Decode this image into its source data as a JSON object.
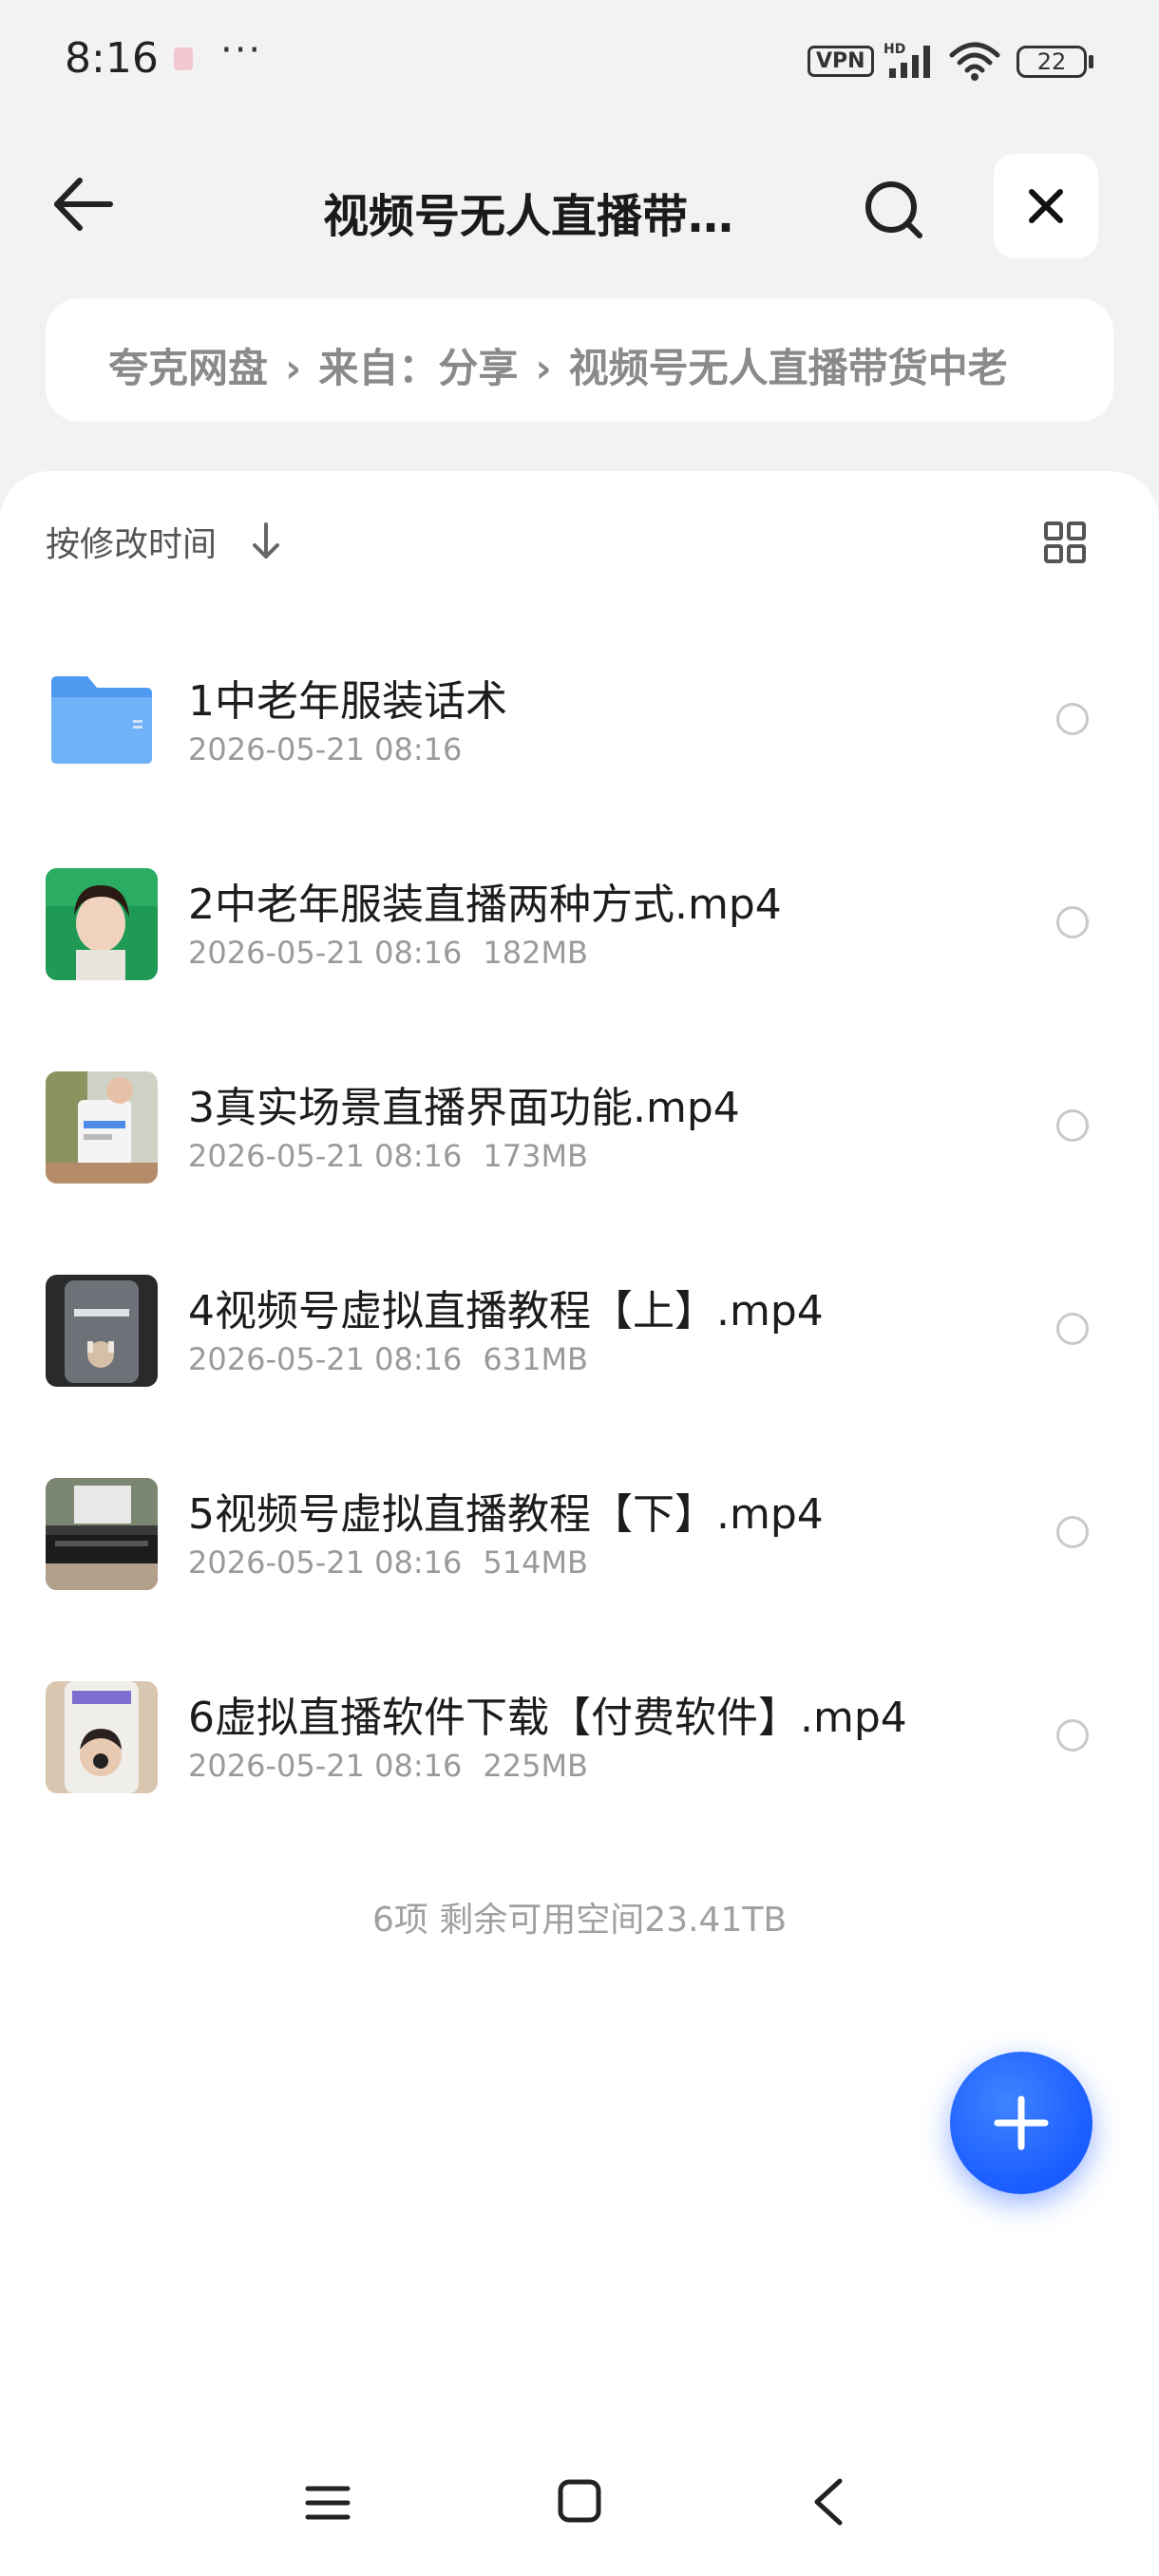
{
  "status_bar": {
    "time": "8:16",
    "more": "···",
    "vpn": "VPN",
    "network": "HD",
    "battery": "22"
  },
  "header": {
    "title": "视频号无人直播带…",
    "back_icon": "arrow-left-icon",
    "search_icon": "search-icon",
    "close_icon": "close-icon"
  },
  "breadcrumb": {
    "items": [
      "夸克网盘",
      "来自：分享",
      "视频号无人直播带货中老"
    ]
  },
  "toolbar": {
    "sort_label": "按修改时间",
    "sort_icon": "arrow-down-icon",
    "view_icon": "grid-view-icon"
  },
  "files": [
    {
      "name": "1中老年服装话术",
      "date": "2026-05-21 08:16",
      "size": "",
      "type": "folder"
    },
    {
      "name": "2中老年服装直播两种方式.mp4",
      "date": "2026-05-21 08:16",
      "size": "182MB",
      "type": "video"
    },
    {
      "name": "3真实场景直播界面功能.mp4",
      "date": "2026-05-21 08:16",
      "size": "173MB",
      "type": "video"
    },
    {
      "name": "4视频号虚拟直播教程【上】.mp4",
      "date": "2026-05-21 08:16",
      "size": "631MB",
      "type": "video"
    },
    {
      "name": "5视频号虚拟直播教程【下】.mp4",
      "date": "2026-05-21 08:16",
      "size": "514MB",
      "type": "video"
    },
    {
      "name": "6虚拟直播软件下载【付费软件】.mp4",
      "date": "2026-05-21 08:16",
      "size": "225MB",
      "type": "video"
    }
  ],
  "summary": "6项 剩余可用空间23.41TB",
  "colors": {
    "accent": "#1a5cff",
    "folder": "#5aa8f5",
    "background": "#f2f2f4"
  }
}
